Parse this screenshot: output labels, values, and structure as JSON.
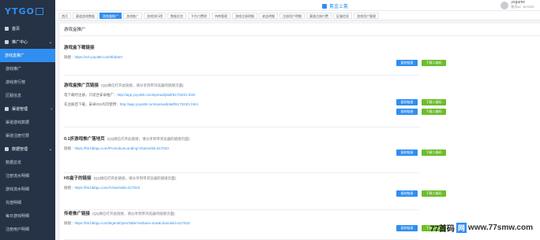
{
  "app": {
    "logo_text": "YTGO",
    "header_title": "氪金上氪",
    "user_name": "yxgame",
    "user_id": "账号id：517023"
  },
  "sidebar": {
    "items": [
      {
        "label": "首页",
        "type": "group"
      },
      {
        "label": "推广中心",
        "type": "group",
        "arrow": "⌄"
      },
      {
        "label": "游戏盒推广",
        "type": "active"
      },
      {
        "label": "游戏推广",
        "type": "sub"
      },
      {
        "label": "游戏排行榜",
        "type": "sub"
      },
      {
        "label": "区服信息",
        "type": "sub"
      },
      {
        "label": "渠道管理",
        "type": "group",
        "arrow": "‹"
      },
      {
        "label": "渠道游戏数据",
        "type": "sub"
      },
      {
        "label": "渠道注册付费",
        "type": "sub"
      },
      {
        "label": "数据管理",
        "type": "group",
        "arrow": "⌄"
      },
      {
        "label": "数据总览",
        "type": "sub"
      },
      {
        "label": "注册流水明细",
        "type": "sub"
      },
      {
        "label": "游戏流水明细",
        "type": "sub"
      },
      {
        "label": "充值明细",
        "type": "sub"
      },
      {
        "label": "每日游戏明细",
        "type": "sub"
      },
      {
        "label": "注册用户明细",
        "type": "sub"
      }
    ]
  },
  "tabs": [
    {
      "label": "首页",
      "active": false
    },
    {
      "label": "渠道游戏数据",
      "active": false
    },
    {
      "label": "游戏盒推广",
      "active": true
    },
    {
      "label": "游戏推广",
      "active": false
    },
    {
      "label": "游戏排行榜",
      "active": false
    },
    {
      "label": "数据总览",
      "active": false
    },
    {
      "label": "平台付费榜",
      "active": false
    },
    {
      "label": "待审管理",
      "active": false
    },
    {
      "label": "游戏注册明细",
      "active": false
    },
    {
      "label": "收益明细",
      "active": false
    },
    {
      "label": "注册用户明细",
      "active": false
    },
    {
      "label": "渠道注册付费",
      "active": false
    },
    {
      "label": "区服信息",
      "active": false
    },
    {
      "label": "游戏用户管理",
      "active": false
    }
  ],
  "panel": {
    "title": "游戏盒推广"
  },
  "buttons": {
    "copy": "复制链接",
    "qr": "下载二维码"
  },
  "cards": [
    {
      "title": "游戏盒下载链接",
      "note": "",
      "lines": [
        {
          "label": "链接：",
          "url": "https://url.yoyo88.com/0bd3w7"
        }
      ]
    },
    {
      "title": "游戏盒推广页链接",
      "note": "(QQ微信打开此链接，请分享到带浏览器的链接页面)",
      "lines": [
        {
          "label": "电下载时注册，只适合安卓推广：",
          "url": "http://app.yoyo88.com/spread/platf/517023/1.html"
        },
        {
          "label": "先注册后下载，安卓IOS均可使用：",
          "url": "http://app.yoyo88.com/spread/platf/517023/1.html"
        }
      ]
    },
    {
      "title": "0.1折游戏推广落地页",
      "note": "(QQ微信打开此链接，请分享到带浏览器的链接页面)",
      "lines": [
        {
          "label": "链接：",
          "url": "https://h5.bbbgu.com/PromotionLanding?channelid=517023"
        }
      ]
    },
    {
      "title": "H5盒子的链接",
      "note": "(QQ微信打开此链接，请分享到带浏览器的链接页面)",
      "lines": [
        {
          "label": "链接：",
          "url": "https://h5.bbbgu.com/?channelid=517023"
        }
      ]
    },
    {
      "title": "传奇推广链接",
      "note": "(QQ微信打开此链接，请分享到带浏览器的链接页面)",
      "lines": [
        {
          "label": "链接：",
          "url": "https://h5.bbbgu.com/legendOpenTable?isshare=true&channelid=517023"
        }
      ]
    }
  ],
  "watermark": {
    "pre": "77首码",
    "box": "网",
    "url": "www.77smw.com"
  }
}
